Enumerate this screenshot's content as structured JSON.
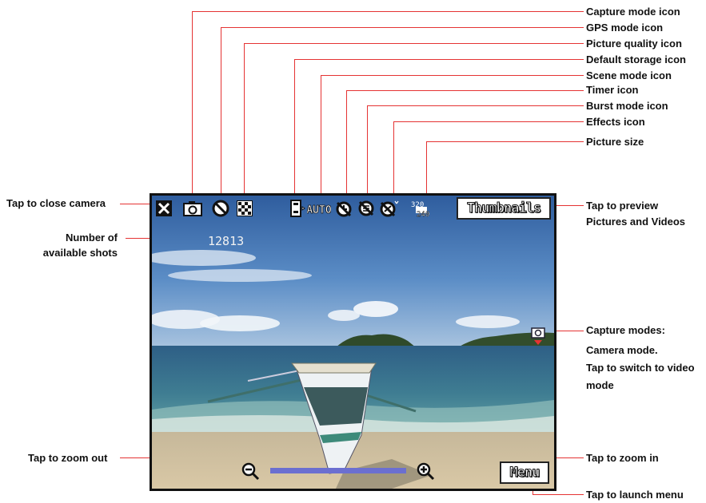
{
  "callouts": {
    "capture_mode_icon": "Capture mode icon",
    "gps_mode_icon": "GPS mode icon",
    "picture_quality_icon": "Picture quality icon",
    "default_storage_icon": "Default storage icon",
    "scene_mode_icon": "Scene mode icon",
    "timer_icon": "Timer icon",
    "burst_mode_icon": "Burst mode icon",
    "effects_icon": "Effects icon",
    "picture_size": "Picture size",
    "tap_close_camera": "Tap to close camera",
    "number_of_shots_line1": "Number of",
    "number_of_shots_line2": "available shots",
    "tap_preview_line1": "Tap to preview",
    "tap_preview_line2": "Pictures and Videos",
    "capture_modes_line1": "Capture modes:",
    "capture_modes_line2": "Camera mode.",
    "capture_modes_line3": "Tap to switch to video",
    "capture_modes_line4": "mode",
    "tap_zoom_out": "Tap to zoom out",
    "tap_zoom_in": "Tap to zoom in",
    "tap_launch_menu": "Tap to launch menu"
  },
  "screen": {
    "thumbnails_label": "Thumbnails",
    "menu_label": "Menu",
    "available_shots": "12813",
    "scene_mode_value": "AUTO",
    "picture_size_width": "320",
    "picture_size_height": "240"
  },
  "colors": {
    "leader_line": "#e53333",
    "zoom_bar": "#6b6fd0"
  }
}
